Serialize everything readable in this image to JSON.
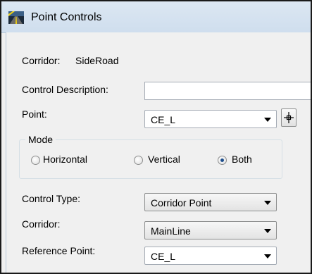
{
  "window": {
    "title": "Point Controls",
    "icon": "road-icon"
  },
  "corridor_info": {
    "label": "Corridor:",
    "value": "SideRoad"
  },
  "control_description": {
    "label": "Control Description:",
    "value": ""
  },
  "point": {
    "label": "Point:",
    "value": "CE_L",
    "pick_icon": "crosshair-icon"
  },
  "mode": {
    "legend": "Mode",
    "options": [
      "Horizontal",
      "Vertical",
      "Both"
    ],
    "selected": "Both"
  },
  "control_type": {
    "label": "Control Type:",
    "value": "Corridor Point"
  },
  "corridor": {
    "label": "Corridor:",
    "value": "MainLine"
  },
  "reference_point": {
    "label": "Reference Point:",
    "value": "CE_L"
  },
  "colors": {
    "titlebar": "#dce7f2",
    "dialog_bg": "#f0f0f0",
    "radio_selected": "#1e4e8c"
  }
}
